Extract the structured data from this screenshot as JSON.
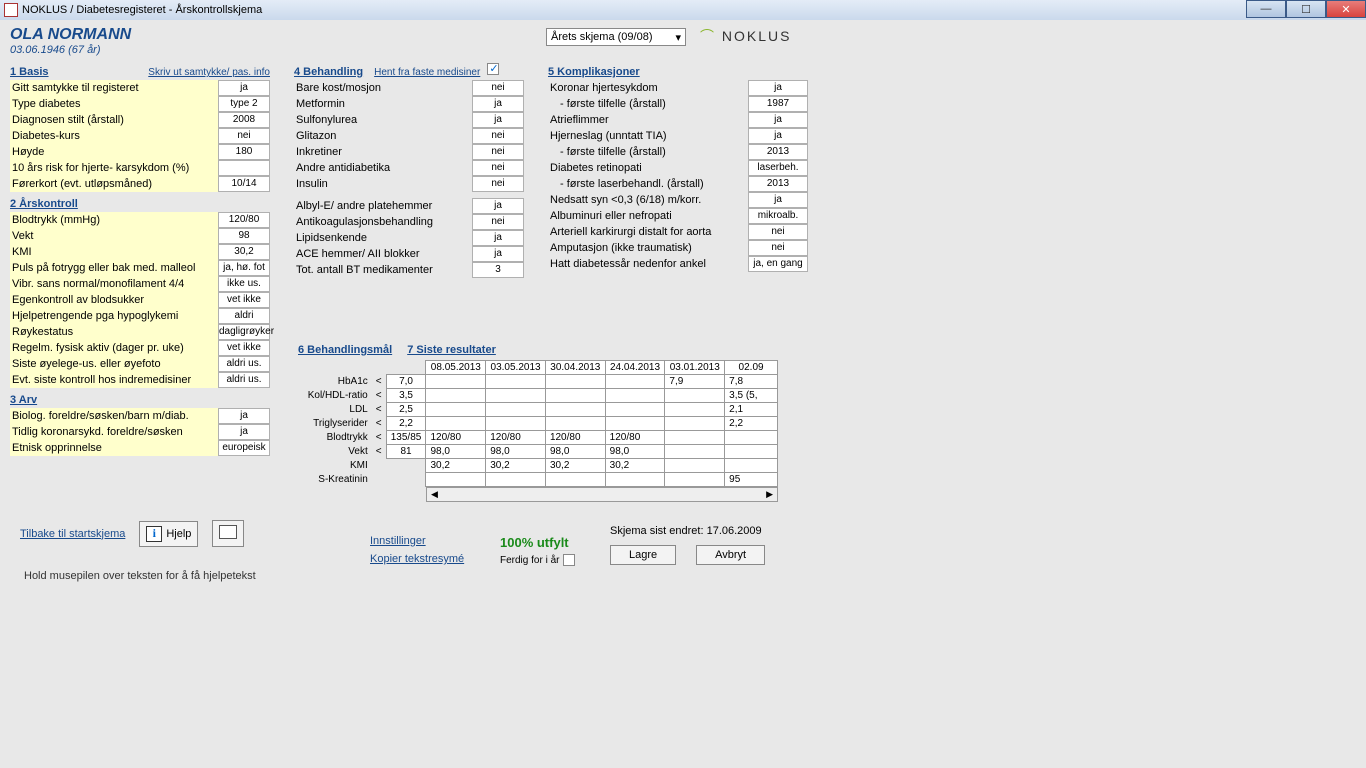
{
  "window": {
    "title": "NOKLUS / Diabetesregisteret - Årskontrollskjema",
    "min": "—",
    "max": "☐",
    "close": "✕"
  },
  "patient": {
    "name": "OLA NORMANN",
    "sub": "03.06.1946 (67 år)"
  },
  "topSelect": "Årets skjema (09/08)",
  "logo": "NOKLUS",
  "links": {
    "samtykke": "Skriv ut samtykke/ pas. info",
    "hent": "Hent fra faste medisiner",
    "innst": "Innstillinger",
    "kopier": "Kopier tekstresymé",
    "tilbake": "Tilbake til startskjema",
    "hjelp": "Hjelp"
  },
  "sections": {
    "s1": "1  Basis",
    "s2": "2  Årskontroll",
    "s3": "3  Arv",
    "s4": "4  Behandling",
    "s5": "5  Komplikasjoner",
    "s6": "6  Behandlingsmål",
    "s7": "7  Siste resultater"
  },
  "basis": [
    {
      "l": "Gitt samtykke til registeret",
      "v": "ja"
    },
    {
      "l": "Type diabetes",
      "v": "type 2"
    },
    {
      "l": "Diagnosen stilt (årstall)",
      "v": "2008"
    },
    {
      "l": "Diabetes-kurs",
      "v": "nei"
    },
    {
      "l": "Høyde",
      "v": "180"
    },
    {
      "l": "10 års risk for hjerte- karsykdom (%)",
      "v": ""
    },
    {
      "l": "Førerkort (evt. utløpsmåned)",
      "v": "10/14"
    }
  ],
  "aars": [
    {
      "l": "Blodtrykk (mmHg)",
      "v": "120/80"
    },
    {
      "l": "Vekt",
      "v": "98"
    },
    {
      "l": "KMI",
      "v": "30,2"
    },
    {
      "l": "Puls på fotrygg eller bak med. malleol",
      "v": "ja, hø. fot"
    },
    {
      "l": "Vibr. sans normal/monofilament 4/4",
      "v": "ikke us."
    },
    {
      "l": "Egenkontroll av blodsukker",
      "v": "vet ikke"
    },
    {
      "l": "Hjelpetrengende pga hypoglykemi",
      "v": "aldri"
    },
    {
      "l": "Røykestatus",
      "v": "dagligrøyker"
    },
    {
      "l": "Regelm. fysisk aktiv (dager pr. uke)",
      "v": "vet ikke"
    },
    {
      "l": "Siste øyelege-us. eller øyefoto",
      "v": "aldri us."
    },
    {
      "l": "Evt. siste kontroll hos indremedisiner",
      "v": "aldri us."
    }
  ],
  "arv": [
    {
      "l": "Biolog. foreldre/søsken/barn m/diab.",
      "v": "ja"
    },
    {
      "l": "Tidlig koronarsykd. foreldre/søsken",
      "v": "ja"
    },
    {
      "l": "Etnisk opprinnelse",
      "v": "europeisk"
    }
  ],
  "beh": [
    {
      "l": "Bare kost/mosjon",
      "v": "nei"
    },
    {
      "l": "Metformin",
      "v": "ja"
    },
    {
      "l": "Sulfonylurea",
      "v": "ja"
    },
    {
      "l": "Glitazon",
      "v": "nei"
    },
    {
      "l": "Inkretiner",
      "v": "nei"
    },
    {
      "l": "Andre antidiabetika",
      "v": "nei"
    },
    {
      "l": "Insulin",
      "v": "nei"
    }
  ],
  "beh2": [
    {
      "l": "Albyl-E/ andre platehemmer",
      "v": "ja"
    },
    {
      "l": "Antikoagulasjonsbehandling",
      "v": "nei"
    },
    {
      "l": "Lipidsenkende",
      "v": "ja"
    },
    {
      "l": "ACE hemmer/ AII blokker",
      "v": "ja"
    },
    {
      "l": "Tot. antall BT medikamenter",
      "v": "3"
    }
  ],
  "komp": [
    {
      "l": "Koronar hjertesykdom",
      "v": "ja",
      "ind": false
    },
    {
      "l": "- første tilfelle (årstall)",
      "v": "1987",
      "ind": true
    },
    {
      "l": "Atrieflimmer",
      "v": "ja",
      "ind": false
    },
    {
      "l": "Hjerneslag (unntatt TIA)",
      "v": "ja",
      "ind": false
    },
    {
      "l": "- første tilfelle (årstall)",
      "v": "2013",
      "ind": true
    },
    {
      "l": "Diabetes retinopati",
      "v": "laserbeh.",
      "ind": false
    },
    {
      "l": "- første laserbehandl. (årstall)",
      "v": "2013",
      "ind": true
    },
    {
      "l": "Nedsatt syn <0,3 (6/18) m/korr.",
      "v": "ja",
      "ind": false
    },
    {
      "l": "Albuminuri eller nefropati",
      "v": "mikroalb.",
      "ind": false
    },
    {
      "l": "Arteriell karkirurgi distalt for aorta",
      "v": "nei",
      "ind": false
    },
    {
      "l": "Amputasjon (ikke traumatisk)",
      "v": "nei",
      "ind": false
    },
    {
      "l": "Hatt diabetessår nedenfor ankel",
      "v": "ja, en gang",
      "ind": false
    }
  ],
  "table": {
    "dates": [
      "08.05.2013",
      "03.05.2013",
      "30.04.2013",
      "24.04.2013",
      "03.01.2013",
      "02.09"
    ],
    "rows": [
      {
        "lbl": "HbA1c",
        "lt": "<",
        "goal": "7,0",
        "c": [
          "",
          "",
          "",
          "",
          "7,9",
          "7,8"
        ]
      },
      {
        "lbl": "Kol/HDL-ratio",
        "lt": "<",
        "goal": "3,5",
        "c": [
          "",
          "",
          "",
          "",
          "",
          "3,5 (5,"
        ]
      },
      {
        "lbl": "LDL",
        "lt": "<",
        "goal": "2,5",
        "c": [
          "",
          "",
          "",
          "",
          "",
          "2,1"
        ]
      },
      {
        "lbl": "Triglyserider",
        "lt": "<",
        "goal": "2,2",
        "c": [
          "",
          "",
          "",
          "",
          "",
          "2,2"
        ]
      },
      {
        "lbl": "Blodtrykk",
        "lt": "<",
        "goal": "135/85",
        "c": [
          "120/80",
          "120/80",
          "120/80",
          "120/80",
          "",
          ""
        ]
      },
      {
        "lbl": "Vekt",
        "lt": "<",
        "goal": "81",
        "c": [
          "98,0",
          "98,0",
          "98,0",
          "98,0",
          "",
          ""
        ]
      },
      {
        "lbl": "KMI",
        "lt": "",
        "goal": "",
        "c": [
          "30,2",
          "30,2",
          "30,2",
          "30,2",
          "",
          ""
        ]
      },
      {
        "lbl": "S-Kreatinin",
        "lt": "",
        "goal": "",
        "c": [
          "",
          "",
          "",
          "",
          "",
          "95"
        ]
      }
    ]
  },
  "status": {
    "sist": "Skjema sist endret: 17.06.2009",
    "pct": "100% utfylt",
    "ferdig": "Ferdig for i år",
    "lagre": "Lagre",
    "avbryt": "Avbryt"
  },
  "hint": "Hold musepilen over teksten for å få hjelpetekst"
}
